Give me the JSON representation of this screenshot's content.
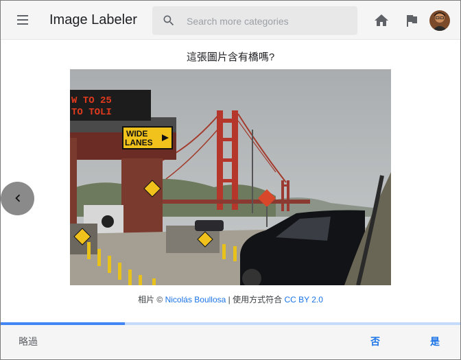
{
  "header": {
    "app_title": "Image Labeler",
    "search": {
      "placeholder": "Search more categories",
      "value": ""
    }
  },
  "main": {
    "question": "這張圖片含有橋嗎?",
    "photo_text": {
      "sign_top_line1": "W TO 25",
      "sign_top_line2": "TO TOLI",
      "wide_lanes_1": "WIDE",
      "wide_lanes_2": "LANES"
    },
    "credit": {
      "prefix": "相片 © ",
      "author": "Nicolás Boullosa",
      "middle": " | 使用方式符合 ",
      "license": "CC BY 2.0"
    }
  },
  "progress": {
    "fraction": 0.27
  },
  "footer": {
    "skip_label": "略過",
    "no_label": "否",
    "yes_label": "是"
  },
  "colors": {
    "accent": "#1a73e8",
    "bridge": "#b5362b",
    "progress_track": "#c6dafc",
    "progress_fill": "#4285f4"
  }
}
